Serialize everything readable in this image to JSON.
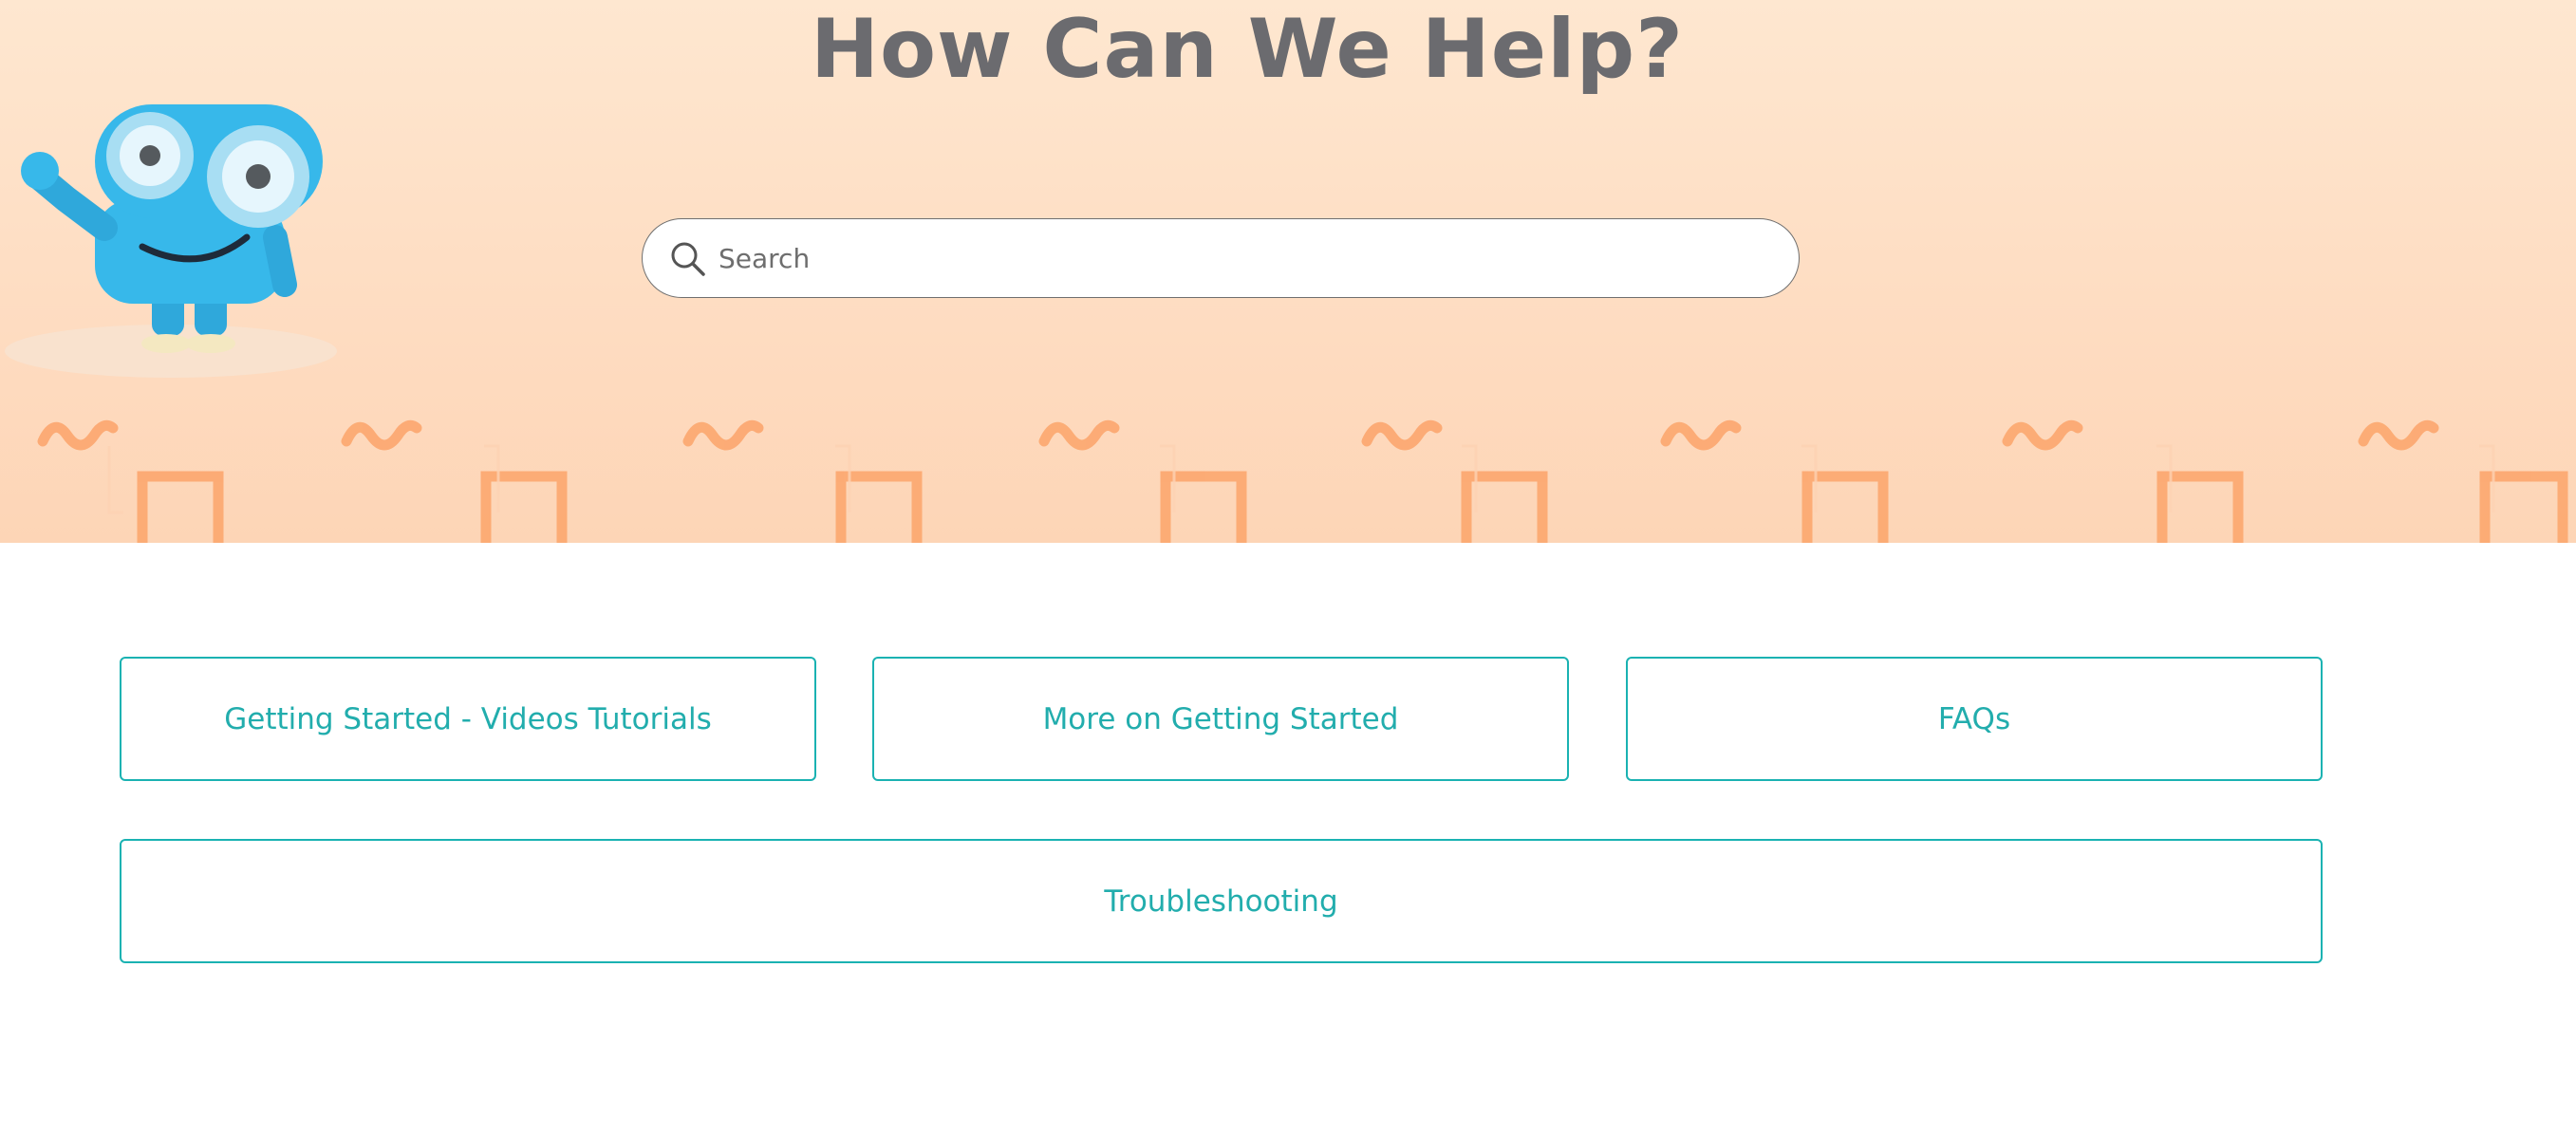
{
  "hero": {
    "title": "How Can We Help?",
    "colors": {
      "background_top": "#fee7d0",
      "background_bottom": "#fdd5b6",
      "title": "#6b6b6f",
      "pattern": "#fca46a",
      "mascot_body": "#37b8ea"
    },
    "mascot_icon": "robot-mascot"
  },
  "search": {
    "placeholder": "Search",
    "value": "",
    "icon": "search-icon"
  },
  "categories": {
    "accent_color": "#1ab2b2",
    "items": [
      {
        "label": "Getting Started - Videos Tutorials"
      },
      {
        "label": "More on Getting Started"
      },
      {
        "label": "FAQs"
      },
      {
        "label": "Troubleshooting"
      }
    ]
  }
}
